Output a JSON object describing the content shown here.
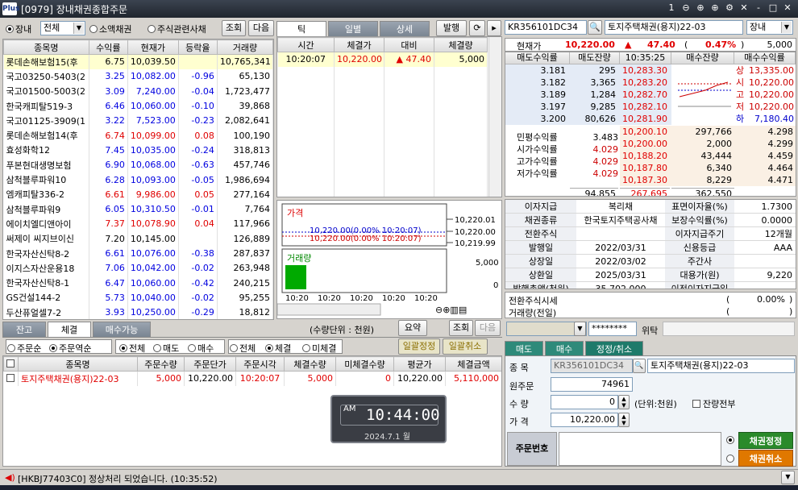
{
  "window": {
    "logo": "Plus",
    "title": "[0979] 장내채권종합주문",
    "controls": [
      "1",
      "⊖",
      "⊕",
      "⊕",
      "⚙",
      "✕",
      "-",
      "□",
      "✕"
    ]
  },
  "left": {
    "market_radio": "장내",
    "market_select": "전체",
    "opt_small": "소액채권",
    "opt_stock": "주식관련사채",
    "query_btn": "조회",
    "next_btn": "다음",
    "headers": [
      "종목명",
      "수익률",
      "현재가",
      "등락율",
      "거래량"
    ],
    "rows": [
      {
        "name": "롯데손해보험15(후",
        "yield": "6.75",
        "price": "10,039.50",
        "chg": "",
        "vol": "10,765,341",
        "pc": "k",
        "cc": "k",
        "sel": true
      },
      {
        "name": "국고03250-5403(2",
        "yield": "3.25",
        "price": "10,082.00",
        "chg": "-0.96",
        "vol": "65,130",
        "pc": "b",
        "cc": "b"
      },
      {
        "name": "국고01500-5003(2",
        "yield": "3.09",
        "price": "7,240.00",
        "chg": "-0.04",
        "vol": "1,723,477",
        "pc": "b",
        "cc": "b"
      },
      {
        "name": "한국캐피탈519-3",
        "yield": "6.46",
        "price": "10,060.00",
        "chg": "-0.10",
        "vol": "39,868",
        "pc": "b",
        "cc": "b"
      },
      {
        "name": "국고01125-3909(1",
        "yield": "3.22",
        "price": "7,523.00",
        "chg": "-0.23",
        "vol": "2,082,641",
        "pc": "b",
        "cc": "b"
      },
      {
        "name": "롯데손해보험14(후",
        "yield": "6.74",
        "price": "10,099.00",
        "chg": "0.08",
        "vol": "100,190",
        "pc": "r",
        "cc": "r"
      },
      {
        "name": "효성화학12",
        "yield": "7.45",
        "price": "10,035.00",
        "chg": "-0.24",
        "vol": "318,813",
        "pc": "b",
        "cc": "b"
      },
      {
        "name": "푸본현대생명보험",
        "yield": "6.90",
        "price": "10,068.00",
        "chg": "-0.63",
        "vol": "457,746",
        "pc": "b",
        "cc": "b"
      },
      {
        "name": "삼척블루파워10",
        "yield": "6.28",
        "price": "10,093.00",
        "chg": "-0.05",
        "vol": "1,986,694",
        "pc": "b",
        "cc": "b"
      },
      {
        "name": "엠캐피탈336-2",
        "yield": "6.61",
        "price": "9,986.00",
        "chg": "0.05",
        "vol": "277,164",
        "pc": "r",
        "cc": "r"
      },
      {
        "name": "삼척블루파워9",
        "yield": "6.05",
        "price": "10,310.50",
        "chg": "-0.01",
        "vol": "7,764",
        "pc": "b",
        "cc": "b"
      },
      {
        "name": "에이치엘디앤아이",
        "yield": "7.37",
        "price": "10,078.90",
        "chg": "0.04",
        "vol": "117,966",
        "pc": "r",
        "cc": "r"
      },
      {
        "name": "써제이 씨지브이신",
        "yield": "7.20",
        "price": "10,145.00",
        "chg": "",
        "vol": "126,889",
        "pc": "k",
        "cc": "k"
      },
      {
        "name": "한국자산신탁8-2",
        "yield": "6.61",
        "price": "10,076.00",
        "chg": "-0.38",
        "vol": "287,837",
        "pc": "b",
        "cc": "b"
      },
      {
        "name": "이지스자산운용18",
        "yield": "7.06",
        "price": "10,042.00",
        "chg": "-0.02",
        "vol": "263,948",
        "pc": "b",
        "cc": "b"
      },
      {
        "name": "한국자산신탁8-1",
        "yield": "6.47",
        "price": "10,060.00",
        "chg": "-0.42",
        "vol": "240,215",
        "pc": "b",
        "cc": "b"
      },
      {
        "name": "GS건설144-2",
        "yield": "5.73",
        "price": "10,040.00",
        "chg": "-0.02",
        "vol": "95,255",
        "pc": "b",
        "cc": "b"
      },
      {
        "name": "두산퓨얼셀7-2",
        "yield": "3.93",
        "price": "10,250.00",
        "chg": "-0.29",
        "vol": "18,812",
        "pc": "b",
        "cc": "b"
      }
    ]
  },
  "ticks": {
    "tabs": [
      "틱",
      "일별",
      "상세"
    ],
    "order_btn": "발행",
    "headers": [
      "시간",
      "체결가",
      "대비",
      "체결량"
    ],
    "rows": [
      {
        "time": "10:20:07",
        "price": "10,220.00",
        "diff": "▲ 47.40",
        "vol": "5,000"
      }
    ]
  },
  "chart": {
    "price_label": "가격",
    "volume_label": "거래량",
    "axis_right": [
      "10,220.01",
      "10,220.00",
      "10,219.99"
    ],
    "vol_axis": [
      "5,000",
      "0"
    ],
    "line1": "10,220.00(0.00% 10:20:07)",
    "line2": "10,220.00(0.00% 10:20:07)",
    "x_ticks": [
      "10:20",
      "10:20",
      "10:20",
      "10:20",
      "10:20"
    ],
    "volume": 5000,
    "volume_max": 5000
  },
  "quote": {
    "code": "KR356101DC34",
    "name": "토지주택채권(용지)22-03",
    "market": "장내",
    "cur_label": "현재가",
    "cur": "10,220.00",
    "arrow": "▲",
    "diff": "47.40",
    "pct_open": "(",
    "pct": "0.47%",
    "pct_close": ")",
    "vol": "5,000",
    "ob_headers": [
      "매도수익률",
      "매도잔량",
      "10:35:25",
      "매수잔량",
      "매수수익률"
    ],
    "asks": [
      {
        "yield": "3.181",
        "qty": "295",
        "price": "10,283.30"
      },
      {
        "yield": "3.182",
        "qty": "3,365",
        "price": "10,283.20"
      },
      {
        "yield": "3.189",
        "qty": "1,284",
        "price": "10,282.70"
      },
      {
        "yield": "3.197",
        "qty": "9,285",
        "price": "10,282.10"
      },
      {
        "yield": "3.200",
        "qty": "80,626",
        "price": "10,281.90"
      }
    ],
    "bids": [
      {
        "price": "10,200.10",
        "qty": "297,766",
        "yield": "4.298"
      },
      {
        "price": "10,200.00",
        "qty": "2,000",
        "yield": "4.299"
      },
      {
        "price": "10,188.20",
        "qty": "43,444",
        "yield": "4.459"
      },
      {
        "price": "10,187.80",
        "qty": "6,340",
        "yield": "4.464"
      },
      {
        "price": "10,187.30",
        "qty": "8,229",
        "yield": "4.471"
      }
    ],
    "side": [
      {
        "k": "상",
        "v": "13,335.00"
      },
      {
        "k": "시",
        "v": "10,220.00"
      },
      {
        "k": "고",
        "v": "10,220.00"
      },
      {
        "k": "저",
        "v": "10,220.00"
      },
      {
        "k": "하",
        "v": "7,180.40"
      }
    ],
    "yields": [
      {
        "k": "민평수익률",
        "v": "3.483"
      },
      {
        "k": "시가수익률",
        "v": "4.029"
      },
      {
        "k": "고가수익률",
        "v": "4.029"
      },
      {
        "k": "저가수익률",
        "v": "4.029"
      }
    ],
    "totals": {
      "ask": "94,855",
      "mid": "267,695",
      "bid": "362,550"
    }
  },
  "info": [
    [
      "이자지급",
      "복리채",
      "표면이자율(%)",
      "1.7300"
    ],
    [
      "채권종류",
      "한국토지주택공사채",
      "보장수익률(%)",
      "0.0000"
    ],
    [
      "전환주식",
      "",
      "이자지급주기",
      "12개월"
    ],
    [
      "발행일",
      "2022/03/31",
      "신용등급",
      "AAA"
    ],
    [
      "상장일",
      "2022/03/02",
      "주간사",
      ""
    ],
    [
      "상환일",
      "2025/03/31",
      "대용가(원)",
      "9,220"
    ],
    [
      "발행총액(천원)",
      "35,702,000",
      "이전이자지급일",
      ""
    ]
  ],
  "conv": {
    "l1": "전환주식시세",
    "l2": "거래량(전일)",
    "v1": "0.00%"
  },
  "bottom": {
    "tabs": [
      "잔고",
      "체결",
      "매수가능"
    ],
    "unit": "(수량단위 : 천원)",
    "summary_btn": "요약",
    "query_btn": "조회",
    "next_btn": "다음",
    "filters": [
      "주문순",
      "주문역순",
      "전체",
      "매도",
      "매수",
      "전체",
      "체결",
      "미체결"
    ],
    "bulk_modify": "일괄정정",
    "bulk_cancel": "일괄취소",
    "headers": [
      "종목명",
      "주문수량",
      "주문단가",
      "주문시각",
      "체결수량",
      "미체결수량",
      "평균가",
      "체결금액"
    ],
    "rows": [
      {
        "name": "토지주택채권(용지)22-03",
        "qty": "5,000",
        "price": "10,220.00",
        "time": "10:20:07",
        "filled": "5,000",
        "unfilled": "0",
        "avg": "10,220.00",
        "amount": "5,110,000"
      }
    ]
  },
  "clock": {
    "ampm": "AM",
    "time": "10:44:00",
    "date": "2024.7.1 월"
  },
  "order": {
    "password": "********",
    "entrust": "위탁",
    "tabs": [
      "매도",
      "매수",
      "정정/취소"
    ],
    "code_label": "종 목",
    "code": "KR356101DC34",
    "name": "토지주택채권(용지)22-03",
    "orig_label": "원주문",
    "orig": "74961",
    "qty_label": "수 량",
    "qty": "0",
    "unit": "(단위:천원)",
    "all_label": "잔량전부",
    "price_label": "가 격",
    "price": "10,220.00",
    "memo_label": "주문번호",
    "modify_btn": "채권정정",
    "cancel_btn": "채권취소"
  },
  "status": {
    "msg": "[HKBJ77403C0] 정상처리 되었습니다. (10:35:52)"
  }
}
